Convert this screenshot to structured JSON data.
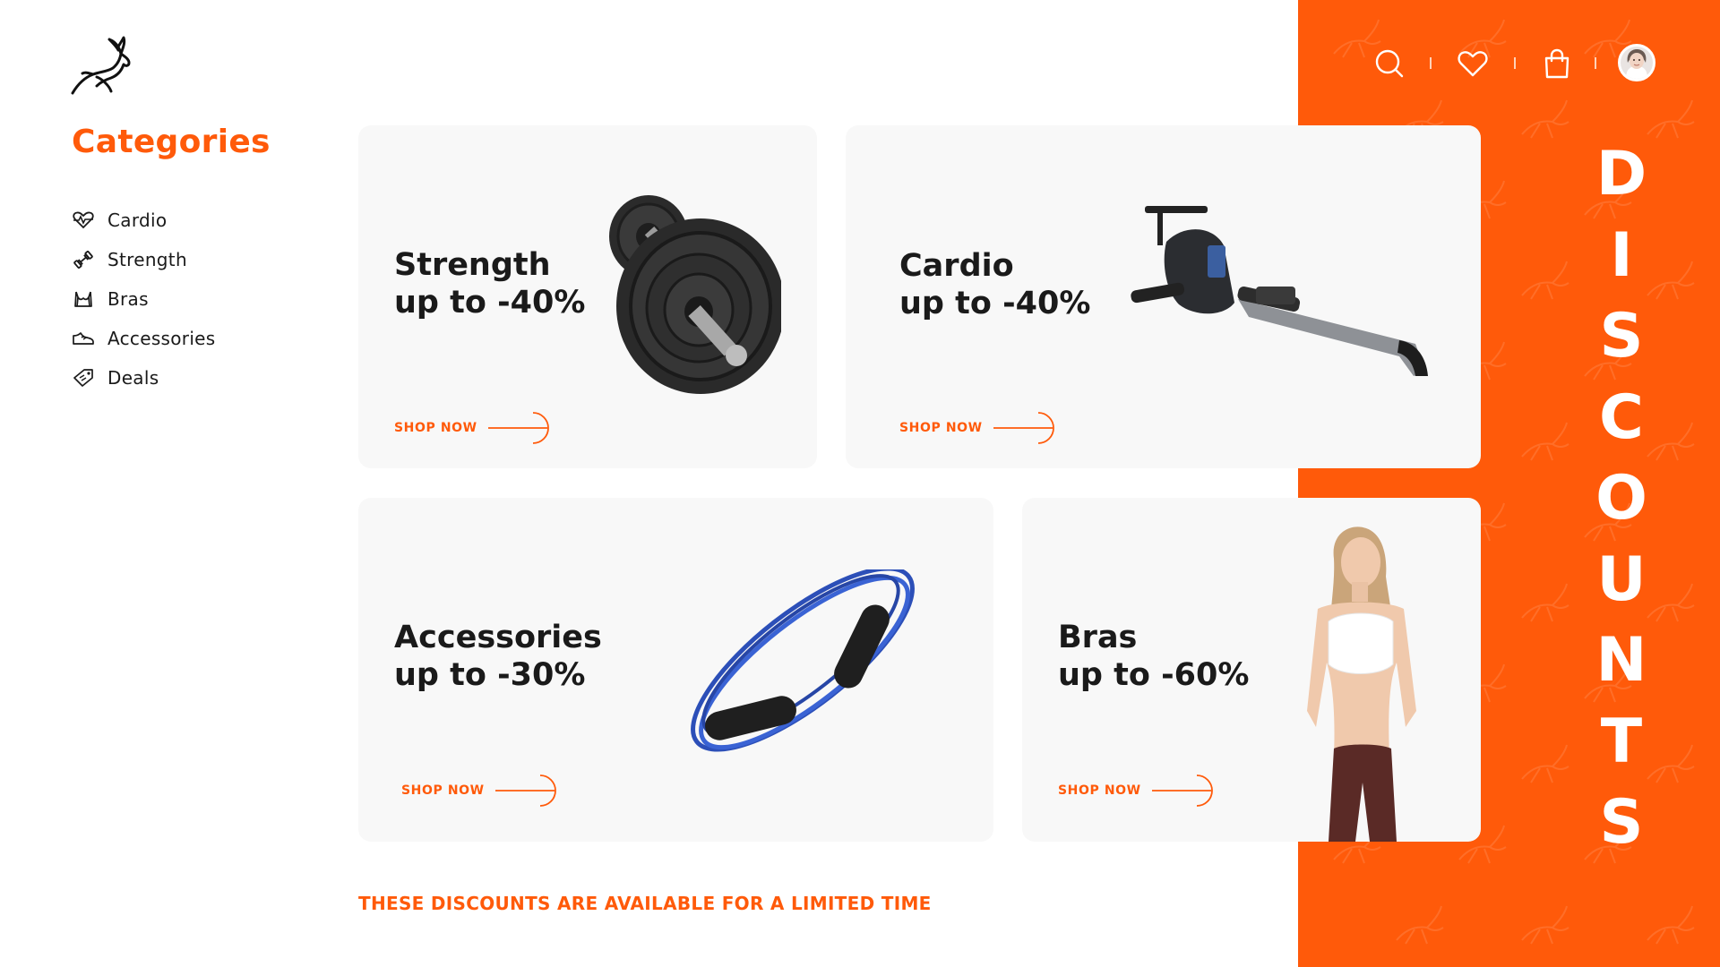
{
  "brand": {
    "accent": "#ff5a0a",
    "logo_icon": "gazelle-icon"
  },
  "sidebar": {
    "title": "Categories",
    "items": [
      {
        "label": "Cardio",
        "icon": "heartbeat-icon"
      },
      {
        "label": "Strength",
        "icon": "dumbbell-icon"
      },
      {
        "label": "Bras",
        "icon": "sports-bra-icon"
      },
      {
        "label": "Accessories",
        "icon": "sneaker-icon"
      },
      {
        "label": "Deals",
        "icon": "tag-icon"
      }
    ]
  },
  "header": {
    "icons": [
      "search-icon",
      "heart-icon",
      "shopping-bag-icon"
    ],
    "avatar": "user-avatar"
  },
  "cards": [
    {
      "title_line1": "Strength",
      "title_line2": "up to -40%",
      "cta": "SHOP NOW",
      "image": "barbell-weight-plates"
    },
    {
      "title_line1": "Cardio",
      "title_line2": "up to -40%",
      "cta": "SHOP NOW",
      "image": "rowing-machine"
    },
    {
      "title_line1": "Accessories",
      "title_line2": "up to -30%",
      "cta": "SHOP NOW",
      "image": "jump-rope"
    },
    {
      "title_line1": "Bras",
      "title_line2": "up to -60%",
      "cta": "SHOP NOW",
      "image": "woman-in-sports-bra"
    }
  ],
  "side_banner": {
    "letters": [
      "D",
      "I",
      "S",
      "C",
      "O",
      "U",
      "N",
      "T",
      "S"
    ]
  },
  "footer_note": "THESE DISCOUNTS ARE AVAILABLE FOR A LIMITED TIME"
}
